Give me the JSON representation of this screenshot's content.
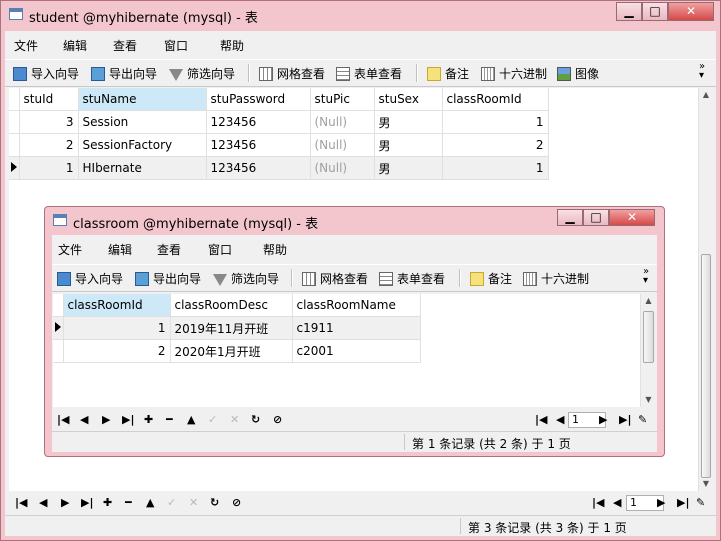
{
  "outer": {
    "title": "student @myhibernate (mysql) - 表",
    "menu": [
      "文件",
      "编辑",
      "查看",
      "窗口",
      "帮助"
    ],
    "toolbar": [
      "导入向导",
      "导出向导",
      "筛选向导",
      "网格查看",
      "表单查看",
      "备注",
      "十六进制",
      "图像"
    ],
    "columns": [
      "stuId",
      "stuName",
      "stuPassword",
      "stuPic",
      "stuSex",
      "classRoomId"
    ],
    "rows": [
      [
        "3",
        "Session",
        "123456",
        "(Null)",
        "男",
        "1"
      ],
      [
        "2",
        "SessionFactory",
        "123456",
        "(Null)",
        "男",
        "2"
      ],
      [
        "1",
        "HIbernate",
        "123456",
        "(Null)",
        "男",
        "1"
      ]
    ],
    "page": "1",
    "status": "第 3 条记录 (共 3 条) 于 1 页"
  },
  "inner": {
    "title": "classroom @myhibernate (mysql) - 表",
    "menu": [
      "文件",
      "编辑",
      "查看",
      "窗口",
      "帮助"
    ],
    "toolbar": [
      "导入向导",
      "导出向导",
      "筛选向导",
      "网格查看",
      "表单查看",
      "备注",
      "十六进制"
    ],
    "columns": [
      "classRoomId",
      "classRoomDesc",
      "classRoomName"
    ],
    "rows": [
      [
        "1",
        "2019年11月开班",
        "c1911"
      ],
      [
        "2",
        "2020年1月开班",
        "c2001"
      ]
    ],
    "page": "1",
    "status": "第 1 条记录 (共 2 条) 于 1 页"
  },
  "icons": {
    "minimize": "minimize-icon",
    "maximize": "maximize-icon",
    "close": "close-icon",
    "nav": [
      "first-record-icon",
      "prev-record-icon",
      "next-record-icon",
      "last-record-icon",
      "add-record-icon",
      "delete-record-icon",
      "apply-icon",
      "confirm-icon",
      "cancel-icon",
      "refresh-icon",
      "stop-icon"
    ]
  }
}
